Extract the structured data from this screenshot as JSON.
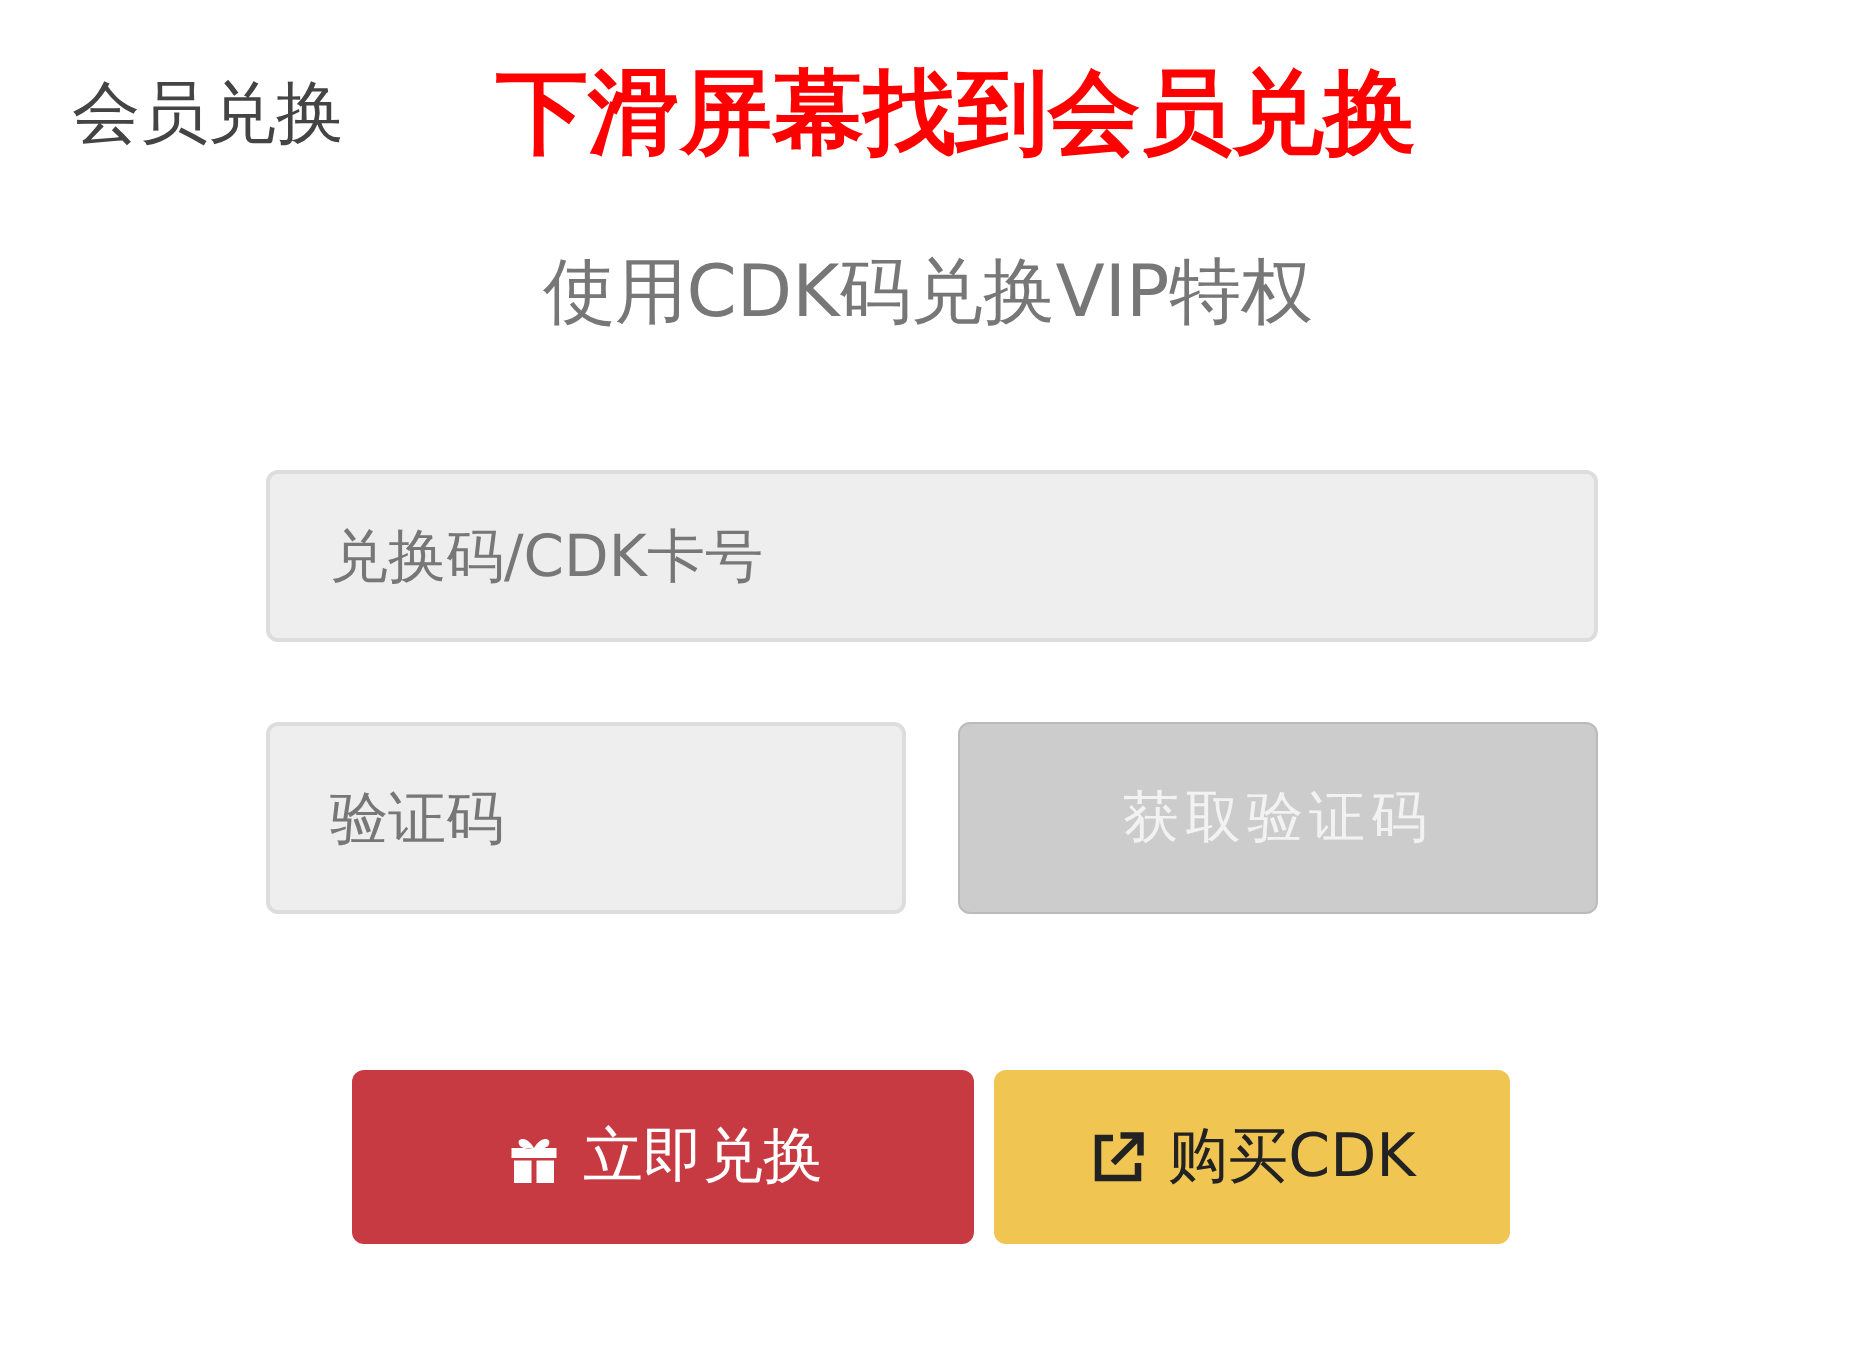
{
  "header": {
    "title": "会员兑换",
    "annotation": "下滑屏幕找到会员兑换"
  },
  "subtitle": "使用CDK码兑换VIP特权",
  "cdk_field": {
    "placeholder": "兑换码/CDK卡号"
  },
  "code_field": {
    "placeholder": "验证码"
  },
  "get_code_button": {
    "label": "获取验证码",
    "disabled": true
  },
  "buttons": [
    {
      "kind": "redeem",
      "label": "立即兑换"
    },
    {
      "kind": "buy",
      "label": "购买CDK"
    }
  ]
}
